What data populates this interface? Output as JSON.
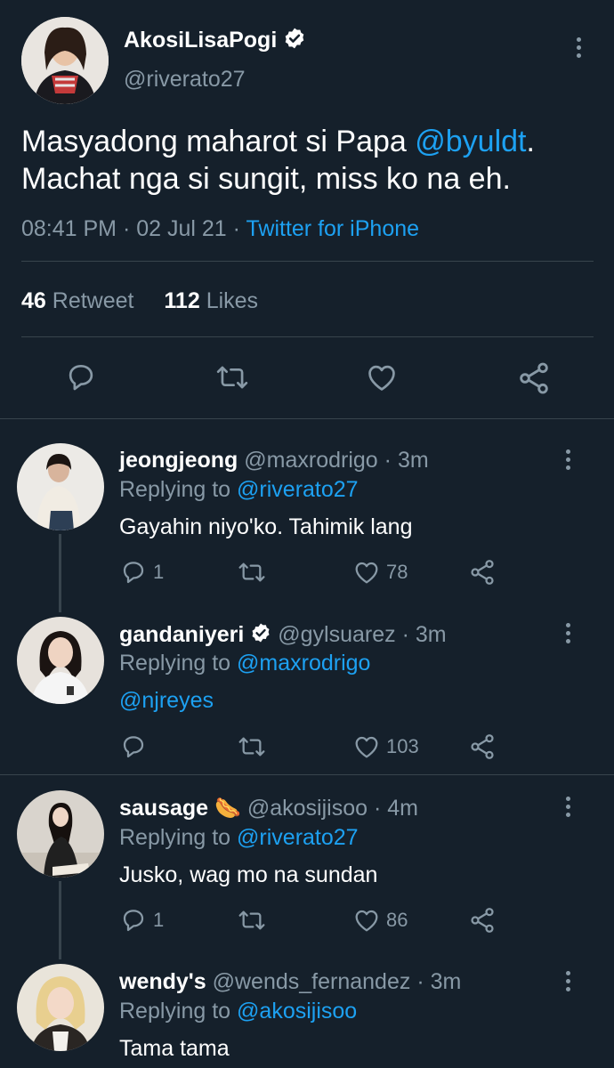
{
  "tweet": {
    "author_name": "AkosiLisaPogi",
    "author_handle": "@riverato27",
    "text_line1_prefix": "Masyadong maharot si Papa ",
    "text_mention": "@byuldt",
    "text_line1_suffix": ".",
    "text_line2": "Machat nga si sungit, miss ko na eh.",
    "time": "08:41 PM",
    "date": "02 Jul 21",
    "separator": "·",
    "source": "Twitter for iPhone",
    "retweet_count": "46",
    "retweet_label": "Retweet",
    "likes_count": "112",
    "likes_label": "Likes"
  },
  "replies": [
    {
      "name": "jeongjeong",
      "handle": "@maxrodrigo",
      "time": "3m",
      "replying_label": "Replying to ",
      "replying_to": "@riverato27",
      "text": "Gayahin niyo'ko. Tahimik lang",
      "reply_count": "1",
      "like_count": "78"
    },
    {
      "name": "gandaniyeri",
      "handle": "@gylsuarez",
      "time": "3m",
      "replying_label": "Replying to ",
      "replying_to": "@maxrodrigo",
      "text": "@njreyes",
      "reply_count": "",
      "like_count": "103"
    },
    {
      "name": "sausage",
      "emoji": "🌭",
      "handle": "@akosijisoo",
      "time": "4m",
      "replying_label": "Replying to ",
      "replying_to": "@riverato27",
      "text": "Jusko, wag mo na sundan",
      "reply_count": "1",
      "like_count": "86"
    },
    {
      "name": "wendy's",
      "handle": "@wends_fernandez",
      "time": "3m",
      "replying_label": "Replying to ",
      "replying_to": "@akosijisoo",
      "text": "Tama tama",
      "reply_count": "",
      "like_count": ""
    }
  ],
  "colors": {
    "background": "#15202b",
    "accent": "#1da1f2",
    "muted": "#8899a6",
    "divider": "#38444d"
  },
  "icons": [
    "verified-badge-icon",
    "more-options-icon",
    "reply-icon",
    "retweet-icon",
    "like-icon",
    "share-icon",
    "hotdog-emoji"
  ]
}
